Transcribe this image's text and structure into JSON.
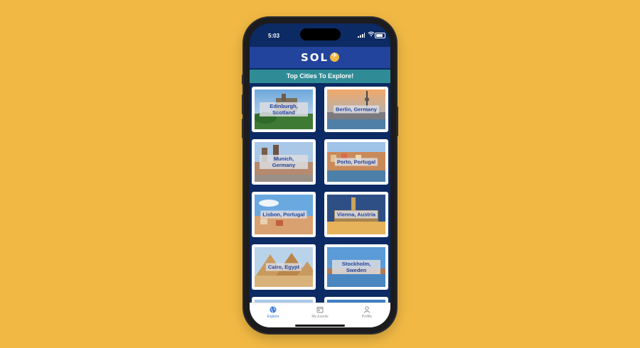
{
  "status_bar": {
    "time": "5:03"
  },
  "header": {
    "logo_text": "SOL"
  },
  "banner": {
    "title": "Top Cities To Explore!"
  },
  "cities": [
    {
      "name": "Edinburgh, Scotland"
    },
    {
      "name": "Berlin, Germany"
    },
    {
      "name": "Munich, Germany"
    },
    {
      "name": "Porto, Portugal"
    },
    {
      "name": "Lisbon, Portugal"
    },
    {
      "name": "Vienna, Austria"
    },
    {
      "name": "Cairo, Egypt"
    },
    {
      "name": "Stockholm, Sweden"
    }
  ],
  "tabs": [
    {
      "label": "Explore",
      "icon": "globe-icon",
      "active": true
    },
    {
      "label": "My Events",
      "icon": "calendar-icon",
      "active": false
    },
    {
      "label": "Profile",
      "icon": "person-icon",
      "active": false
    }
  ],
  "colors": {
    "background": "#f1b944",
    "header": "#23449c",
    "banner": "#2f8c96",
    "screen": "#0c2a63",
    "active_tab": "#3a7bd5"
  }
}
